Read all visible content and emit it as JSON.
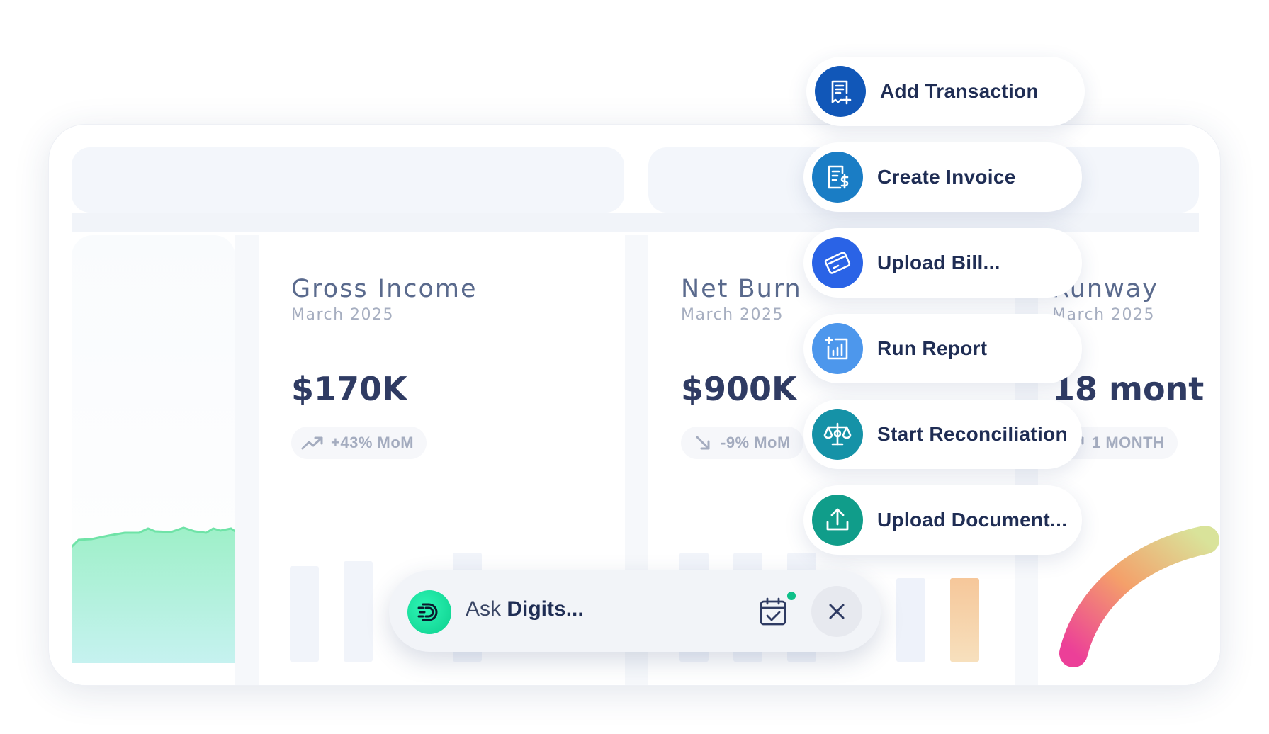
{
  "colors": {
    "accent_navy": "#1f2d54",
    "muted_text": "#a6aec0",
    "ask_logo_green": "#13e29f",
    "status_dot": "#0fc089"
  },
  "cards": [
    {
      "title": "Gross Income",
      "subtitle": "March 2025",
      "value": "$170K",
      "trend": "+43% MoM",
      "trend_icon": "trend-up-icon"
    },
    {
      "title": "Net Burn",
      "subtitle": "March 2025",
      "value": "$900K",
      "trend": "-9% MoM",
      "trend_icon": "trend-down-icon"
    },
    {
      "title": "Runway",
      "subtitle": "March 2025",
      "value": "18 mont",
      "trend": "1 MONTH",
      "trend_icon": "trend-up-icon"
    }
  ],
  "actions": [
    {
      "label": "Add Transaction",
      "icon": "receipt-add-icon",
      "color": "#1157b8"
    },
    {
      "label": "Create Invoice",
      "icon": "invoice-dollar-icon",
      "color": "#1a7dc5"
    },
    {
      "label": "Upload Bill...",
      "icon": "credit-card-icon",
      "color": "#2a63e6"
    },
    {
      "label": "Run Report",
      "icon": "report-chart-icon",
      "color": "#4d97ec"
    },
    {
      "label": "Start Reconciliation",
      "icon": "balance-scale-icon",
      "color": "#1592a7"
    },
    {
      "label": "Upload Document...",
      "icon": "upload-icon",
      "color": "#109d8a"
    }
  ],
  "ask_bar": {
    "prefix": "Ask ",
    "brand": "Digits...",
    "logo_icon": "digits-logo-icon",
    "calendar_icon": "calendar-check-icon",
    "close_icon": "close-icon"
  }
}
